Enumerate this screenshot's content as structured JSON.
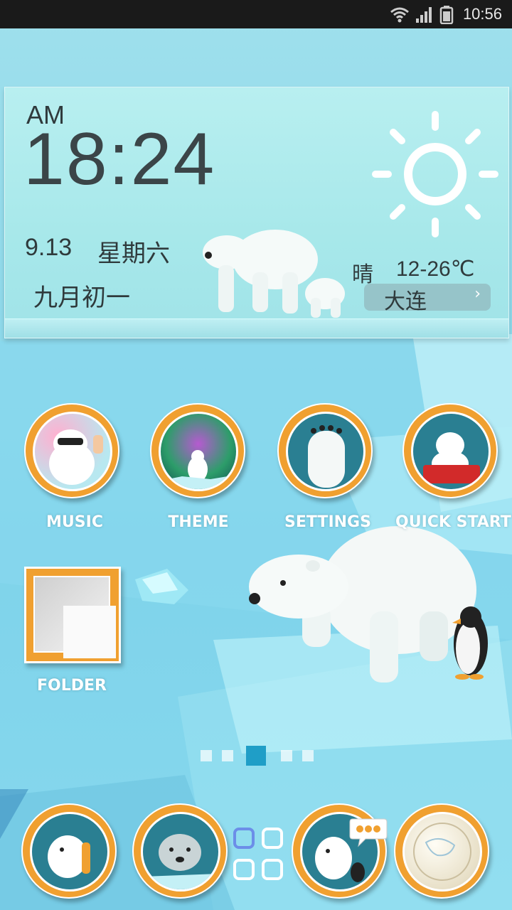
{
  "status_bar": {
    "time": "10:56"
  },
  "widget": {
    "ampm": "AM",
    "clock": "18:24",
    "date": "9.13",
    "weekday": "星期六",
    "lunar_date": "九月初一",
    "weather": "晴",
    "temperature": "12-26℃",
    "city": "大连",
    "weather_icon": "sun-icon"
  },
  "apps": [
    {
      "label": "MUSIC",
      "icon": "polar-bear-music-icon"
    },
    {
      "label": "THEME",
      "icon": "polar-bear-aurora-icon"
    },
    {
      "label": "SETTINGS",
      "icon": "polar-bear-paw-icon"
    },
    {
      "label": "QUICK START",
      "icon": "polar-bear-sled-icon"
    }
  ],
  "folder": {
    "label": "FOLDER"
  },
  "icon_ring_text": "Polar Bear",
  "page_indicator": {
    "total": 5,
    "current": 3
  },
  "dock": [
    {
      "icon": "phone-icon"
    },
    {
      "icon": "contacts-icon"
    },
    {
      "icon": "app-drawer-icon"
    },
    {
      "icon": "messaging-icon"
    },
    {
      "icon": "browser-globe-icon"
    }
  ],
  "colors": {
    "icon_ring": "#f0a030",
    "accent": "#1f9ec7",
    "background": "#8fd9ea"
  }
}
